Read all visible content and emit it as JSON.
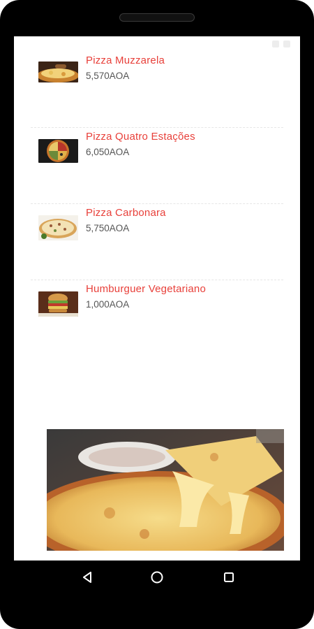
{
  "menu_items": [
    {
      "name": "Pizza Muzzarela",
      "price": "5,570AOA"
    },
    {
      "name": "Pizza Quatro Estações",
      "price": "6,050AOA"
    },
    {
      "name": "Pizza Carbonara",
      "price": "5,750AOA"
    },
    {
      "name": "Humburguer Vegetariano",
      "price": "1,000AOA"
    }
  ],
  "colors": {
    "item_name": "#e8403a",
    "price": "#555555",
    "frame": "#000000"
  },
  "icons": {
    "nav_back": "back-triangle-icon",
    "nav_home": "home-circle-icon",
    "nav_recents": "recents-square-icon"
  }
}
